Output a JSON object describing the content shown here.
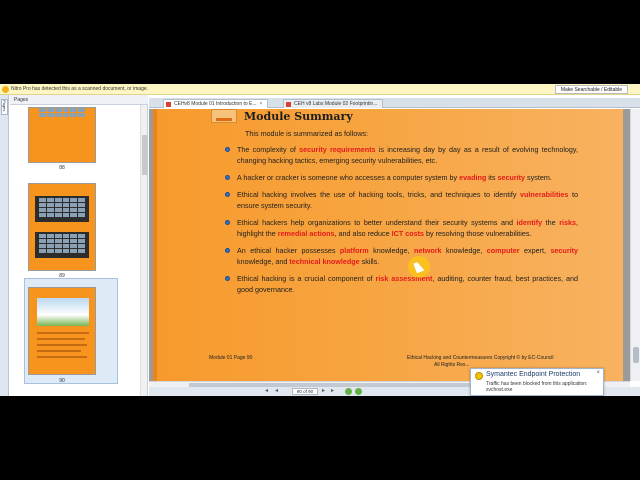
{
  "infobar": {
    "message": "Nitro Pro has detected this as a scanned document, or image.",
    "button_label": "Make Searchable / Editable"
  },
  "rail": {
    "tab_label": "Pages"
  },
  "pages_panel": {
    "title": "Pages",
    "thumbnails": [
      {
        "label": "88"
      },
      {
        "label": "89"
      },
      {
        "label": "90"
      }
    ]
  },
  "tabs": [
    {
      "label": "CEHv8 Module 01 Introduction to E...",
      "active": true
    },
    {
      "label": "CEH v8 Labs Module 02 Footprintin...",
      "active": false
    }
  ],
  "document": {
    "title": "Module Summary",
    "intro": "This module is summarized as follows:",
    "bullets": [
      [
        {
          "t": "The complexity of "
        },
        {
          "t": "security requirements",
          "h": true
        },
        {
          "t": " is increasing day by day as a result of evolving technology, changing hacking tactics, emerging security vulnerabilities, etc."
        }
      ],
      [
        {
          "t": "A hacker or cracker is someone who accesses a computer system by "
        },
        {
          "t": "evading",
          "h": true
        },
        {
          "t": " its "
        },
        {
          "t": "security",
          "h": true
        },
        {
          "t": " system."
        }
      ],
      [
        {
          "t": "Ethical hacking involves the use of hacking tools, tricks, and techniques to identify "
        },
        {
          "t": "vulnerabilities",
          "h": true
        },
        {
          "t": " to ensure system security."
        }
      ],
      [
        {
          "t": "Ethical hackers help organizations to better understand their security systems and "
        },
        {
          "t": "identify",
          "h": true
        },
        {
          "t": " the "
        },
        {
          "t": "risks",
          "h": true
        },
        {
          "t": ", highlight the "
        },
        {
          "t": "remedial actions",
          "h": true
        },
        {
          "t": ", and also reduce "
        },
        {
          "t": "ICT costs",
          "h": true
        },
        {
          "t": " by resolving those vulnerabilities."
        }
      ],
      [
        {
          "t": "An ethical hacker possesses "
        },
        {
          "t": "platform",
          "h": true
        },
        {
          "t": " knowledge, "
        },
        {
          "t": "network",
          "h": true
        },
        {
          "t": " knowledge, "
        },
        {
          "t": "computer",
          "h": true
        },
        {
          "t": " expert, "
        },
        {
          "t": "security",
          "h": true
        },
        {
          "t": " knowledge, and "
        },
        {
          "t": "technical knowledge",
          "h": true
        },
        {
          "t": " skills."
        }
      ],
      [
        {
          "t": "Ethical hacking is a crucial component of "
        },
        {
          "t": "risk assessment",
          "h": true
        },
        {
          "t": ", auditing, counter fraud, best practices, and good governance."
        }
      ]
    ],
    "footer_left": "Module 01 Page 90",
    "footer_right": "Ethical Hacking and Countermeasures Copyright © by EC-Council",
    "footer_right2": "All Rights Res..."
  },
  "statusbar": {
    "page_indicator": "90 of 90"
  },
  "notification": {
    "title": "Symantec Endpoint Protection",
    "close": "×",
    "body_line1": "Traffic has been blocked from this application:",
    "body_line2": "svchost.exe"
  },
  "colors": {
    "page_orange": "#f7a33e",
    "highlight_red": "#e41b1b",
    "bullet_blue": "#3a6fc4"
  }
}
